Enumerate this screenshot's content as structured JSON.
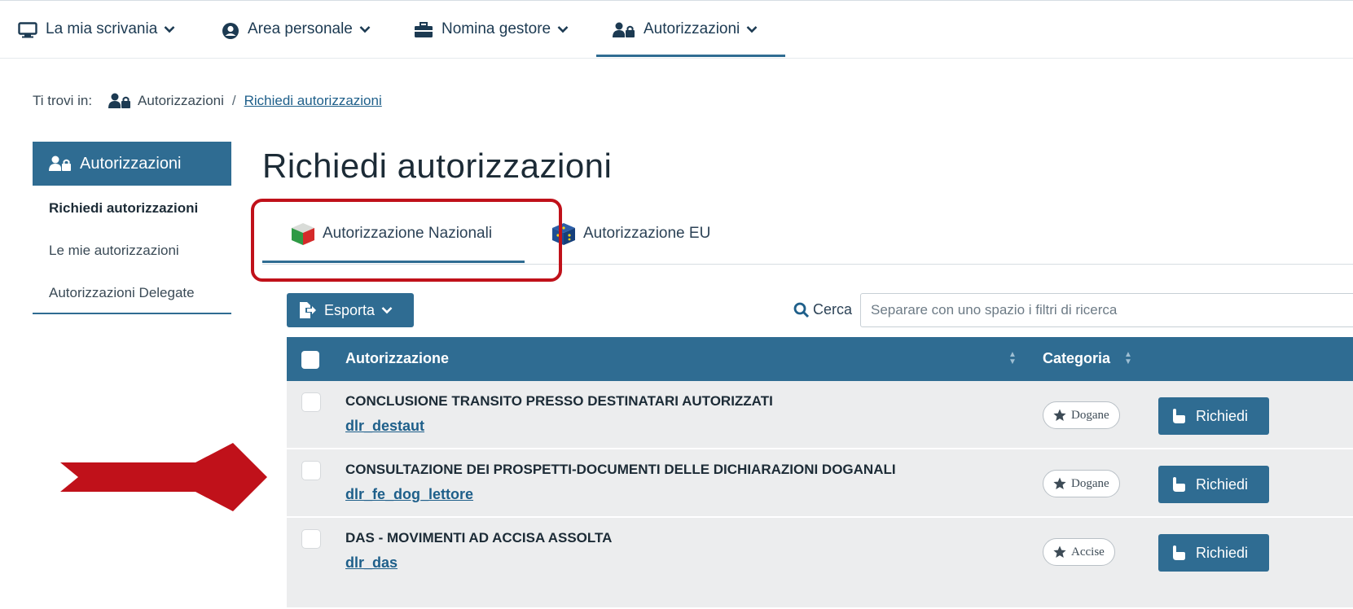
{
  "topnav": {
    "items": [
      {
        "label": "La mia scrivania",
        "icon": "monitor-icon"
      },
      {
        "label": "Area personale",
        "icon": "user-circle-icon"
      },
      {
        "label": "Nomina gestore",
        "icon": "briefcase-icon"
      },
      {
        "label": "Autorizzazioni",
        "icon": "user-lock-icon"
      }
    ],
    "active": "Autorizzazioni"
  },
  "breadcrumb": {
    "prefix": "Ti trovi in:",
    "items": [
      "Autorizzazioni",
      "Richiedi autorizzazioni"
    ],
    "separator": "/"
  },
  "sidebar": {
    "header": "Autorizzazioni",
    "items": [
      {
        "label": "Richiedi autorizzazioni",
        "active": true
      },
      {
        "label": "Le mie autorizzazioni",
        "active": false
      },
      {
        "label": "Autorizzazioni Delegate",
        "active": false
      }
    ]
  },
  "page": {
    "title": "Richiedi autorizzazioni"
  },
  "tabs": [
    {
      "label": "Autorizzazione Nazionali",
      "icon": "italy-cube-icon",
      "active": true
    },
    {
      "label": "Autorizzazione EU",
      "icon": "eu-cube-icon",
      "active": false
    }
  ],
  "toolbar": {
    "export_label": "Esporta",
    "search_label": "Cerca",
    "search_placeholder": "Separare con uno spazio i filtri di ricerca"
  },
  "table": {
    "columns": [
      "Autorizzazione",
      "Categoria"
    ],
    "rows": [
      {
        "title": "CONCLUSIONE TRANSITO PRESSO DESTINATARI AUTORIZZATI",
        "code": "dlr_destaut",
        "category": "Dogane",
        "action": "Richiedi"
      },
      {
        "title": "CONSULTAZIONE DEI PROSPETTI-DOCUMENTI DELLE DICHIARAZIONI DOGANALI",
        "code": "dlr_fe_dog_lettore",
        "category": "Dogane",
        "action": "Richiedi"
      },
      {
        "title": "DAS - MOVIMENTI AD ACCISA ASSOLTA",
        "code": "dlr_das",
        "category": "Accise",
        "action": "Richiedi"
      }
    ]
  },
  "colors": {
    "primary": "#2f6c92",
    "highlight": "#c0111a",
    "row_bg": "#ecedee"
  }
}
